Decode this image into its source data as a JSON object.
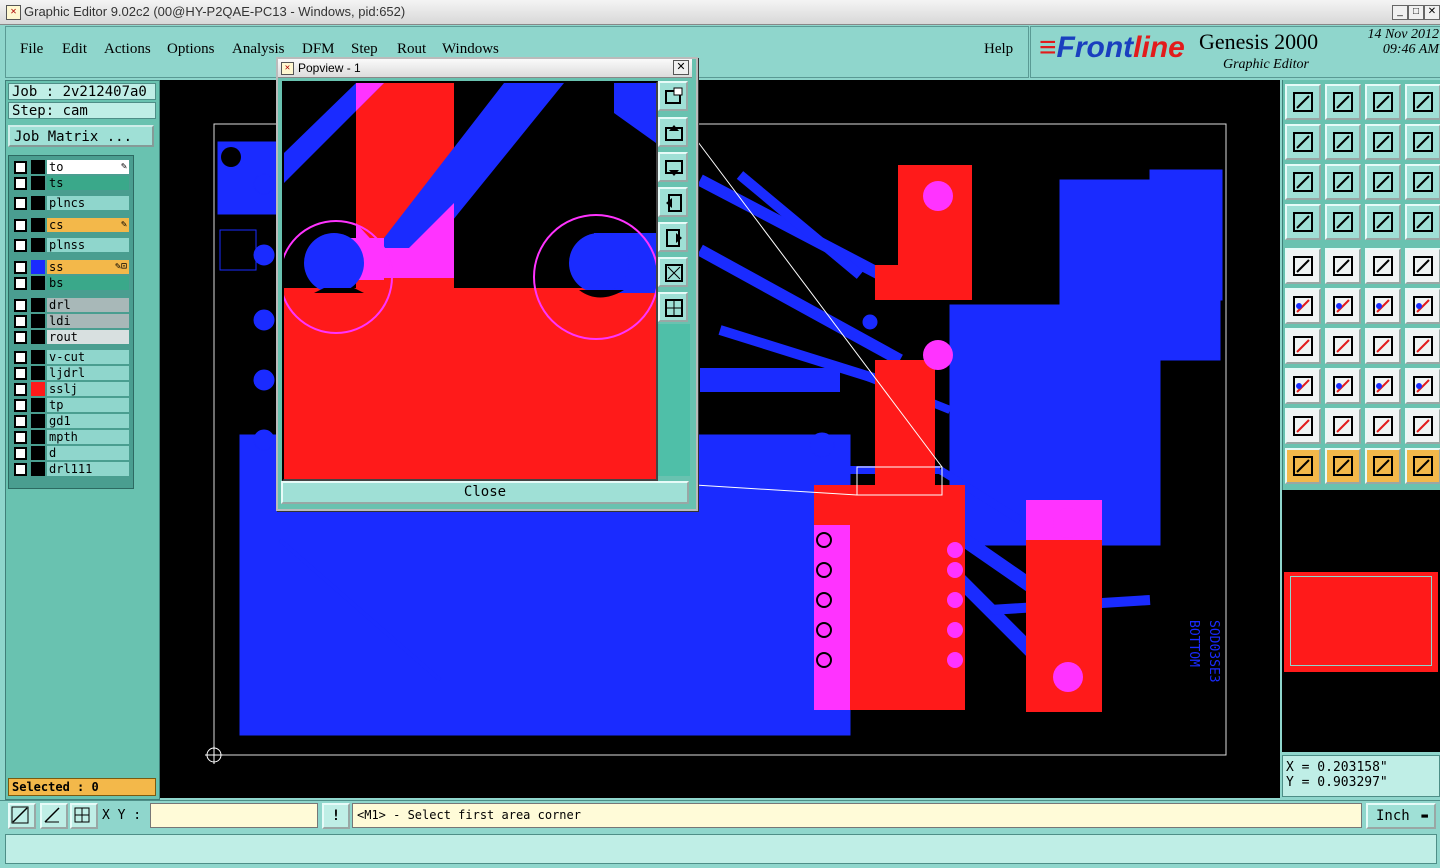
{
  "window": {
    "title": "Graphic Editor 9.02c2 (00@HY-P2QAE-PC13 - Windows, pid:652)",
    "minimize": "_",
    "maximize": "□",
    "close": "✕"
  },
  "menu": {
    "items": [
      "File",
      "Edit",
      "Actions",
      "Options",
      "Analysis",
      "DFM",
      "Step",
      "Rout",
      "Windows"
    ],
    "help": "Help"
  },
  "brand": {
    "logo_a": "Front",
    "logo_b": "line",
    "product": "Genesis 2000",
    "subtitle": "Graphic Editor",
    "date": "14 Nov 2012",
    "time": "09:46 AM"
  },
  "job": {
    "job_label": "Job : 2v212407a0",
    "step_label": "Step: cam",
    "matrix_button": "Job Matrix ..."
  },
  "layers": [
    {
      "name": "to",
      "color": "#ffffff",
      "swatch": "#000000",
      "marker": "✎"
    },
    {
      "name": "ts",
      "color": "#3aa88a",
      "swatch": "#000000",
      "marker": ""
    },
    {
      "name": "plncs",
      "color": "#8fd6cc",
      "swatch": "#000000",
      "marker": ""
    },
    {
      "name": "cs",
      "color": "#f3b84a",
      "swatch": "#000000",
      "marker": "✎"
    },
    {
      "name": "plnss",
      "color": "#8fd6cc",
      "swatch": "#000000",
      "marker": ""
    },
    {
      "name": "ss",
      "color": "#f3b84a",
      "swatch": "#1a2bff",
      "marker": "✎⊡"
    },
    {
      "name": "bs",
      "color": "#3aa88a",
      "swatch": "#000000",
      "marker": ""
    },
    {
      "name": "drl",
      "color": "#a8b8b8",
      "swatch": "#000000",
      "marker": ""
    },
    {
      "name": "ldi",
      "color": "#a8b8b8",
      "swatch": "#000000",
      "marker": ""
    },
    {
      "name": "rout",
      "color": "#d8e0e0",
      "swatch": "#000000",
      "marker": ""
    },
    {
      "name": "v-cut",
      "color": "#8fd6cc",
      "swatch": "#000000",
      "marker": ""
    },
    {
      "name": "ljdrl",
      "color": "#8fd6cc",
      "swatch": "#000000",
      "marker": ""
    },
    {
      "name": "sslj",
      "color": "#8fd6cc",
      "swatch": "#ff1a1a",
      "marker": ""
    },
    {
      "name": "tp",
      "color": "#8fd6cc",
      "swatch": "#000000",
      "marker": ""
    },
    {
      "name": "gd1",
      "color": "#8fd6cc",
      "swatch": "#000000",
      "marker": ""
    },
    {
      "name": "mpth",
      "color": "#8fd6cc",
      "swatch": "#000000",
      "marker": ""
    },
    {
      "name": "d",
      "color": "#8fd6cc",
      "swatch": "#000000",
      "marker": ""
    },
    {
      "name": "drl111",
      "color": "#8fd6cc",
      "swatch": "#000000",
      "marker": ""
    }
  ],
  "selected": "Selected : 0",
  "popview": {
    "title": "Popview - 1",
    "close_x": "✕",
    "close_button": "Close"
  },
  "board_text": [
    "BOTTOM",
    "SOD03SE3"
  ],
  "coords": {
    "x": "X = 0.203158\"",
    "y": "Y = 0.903297\""
  },
  "bottom": {
    "xy_label": "X Y :",
    "xy_value": "",
    "warn": "!",
    "prompt": "<M1> - Select first area corner",
    "unit": "Inch"
  },
  "colors": {
    "accent": "#8fd6cc",
    "panel": "#69c2b0",
    "layer_blue": "#1a2bff",
    "layer_red": "#ff1a1a",
    "overlap": "#ff33ff"
  }
}
